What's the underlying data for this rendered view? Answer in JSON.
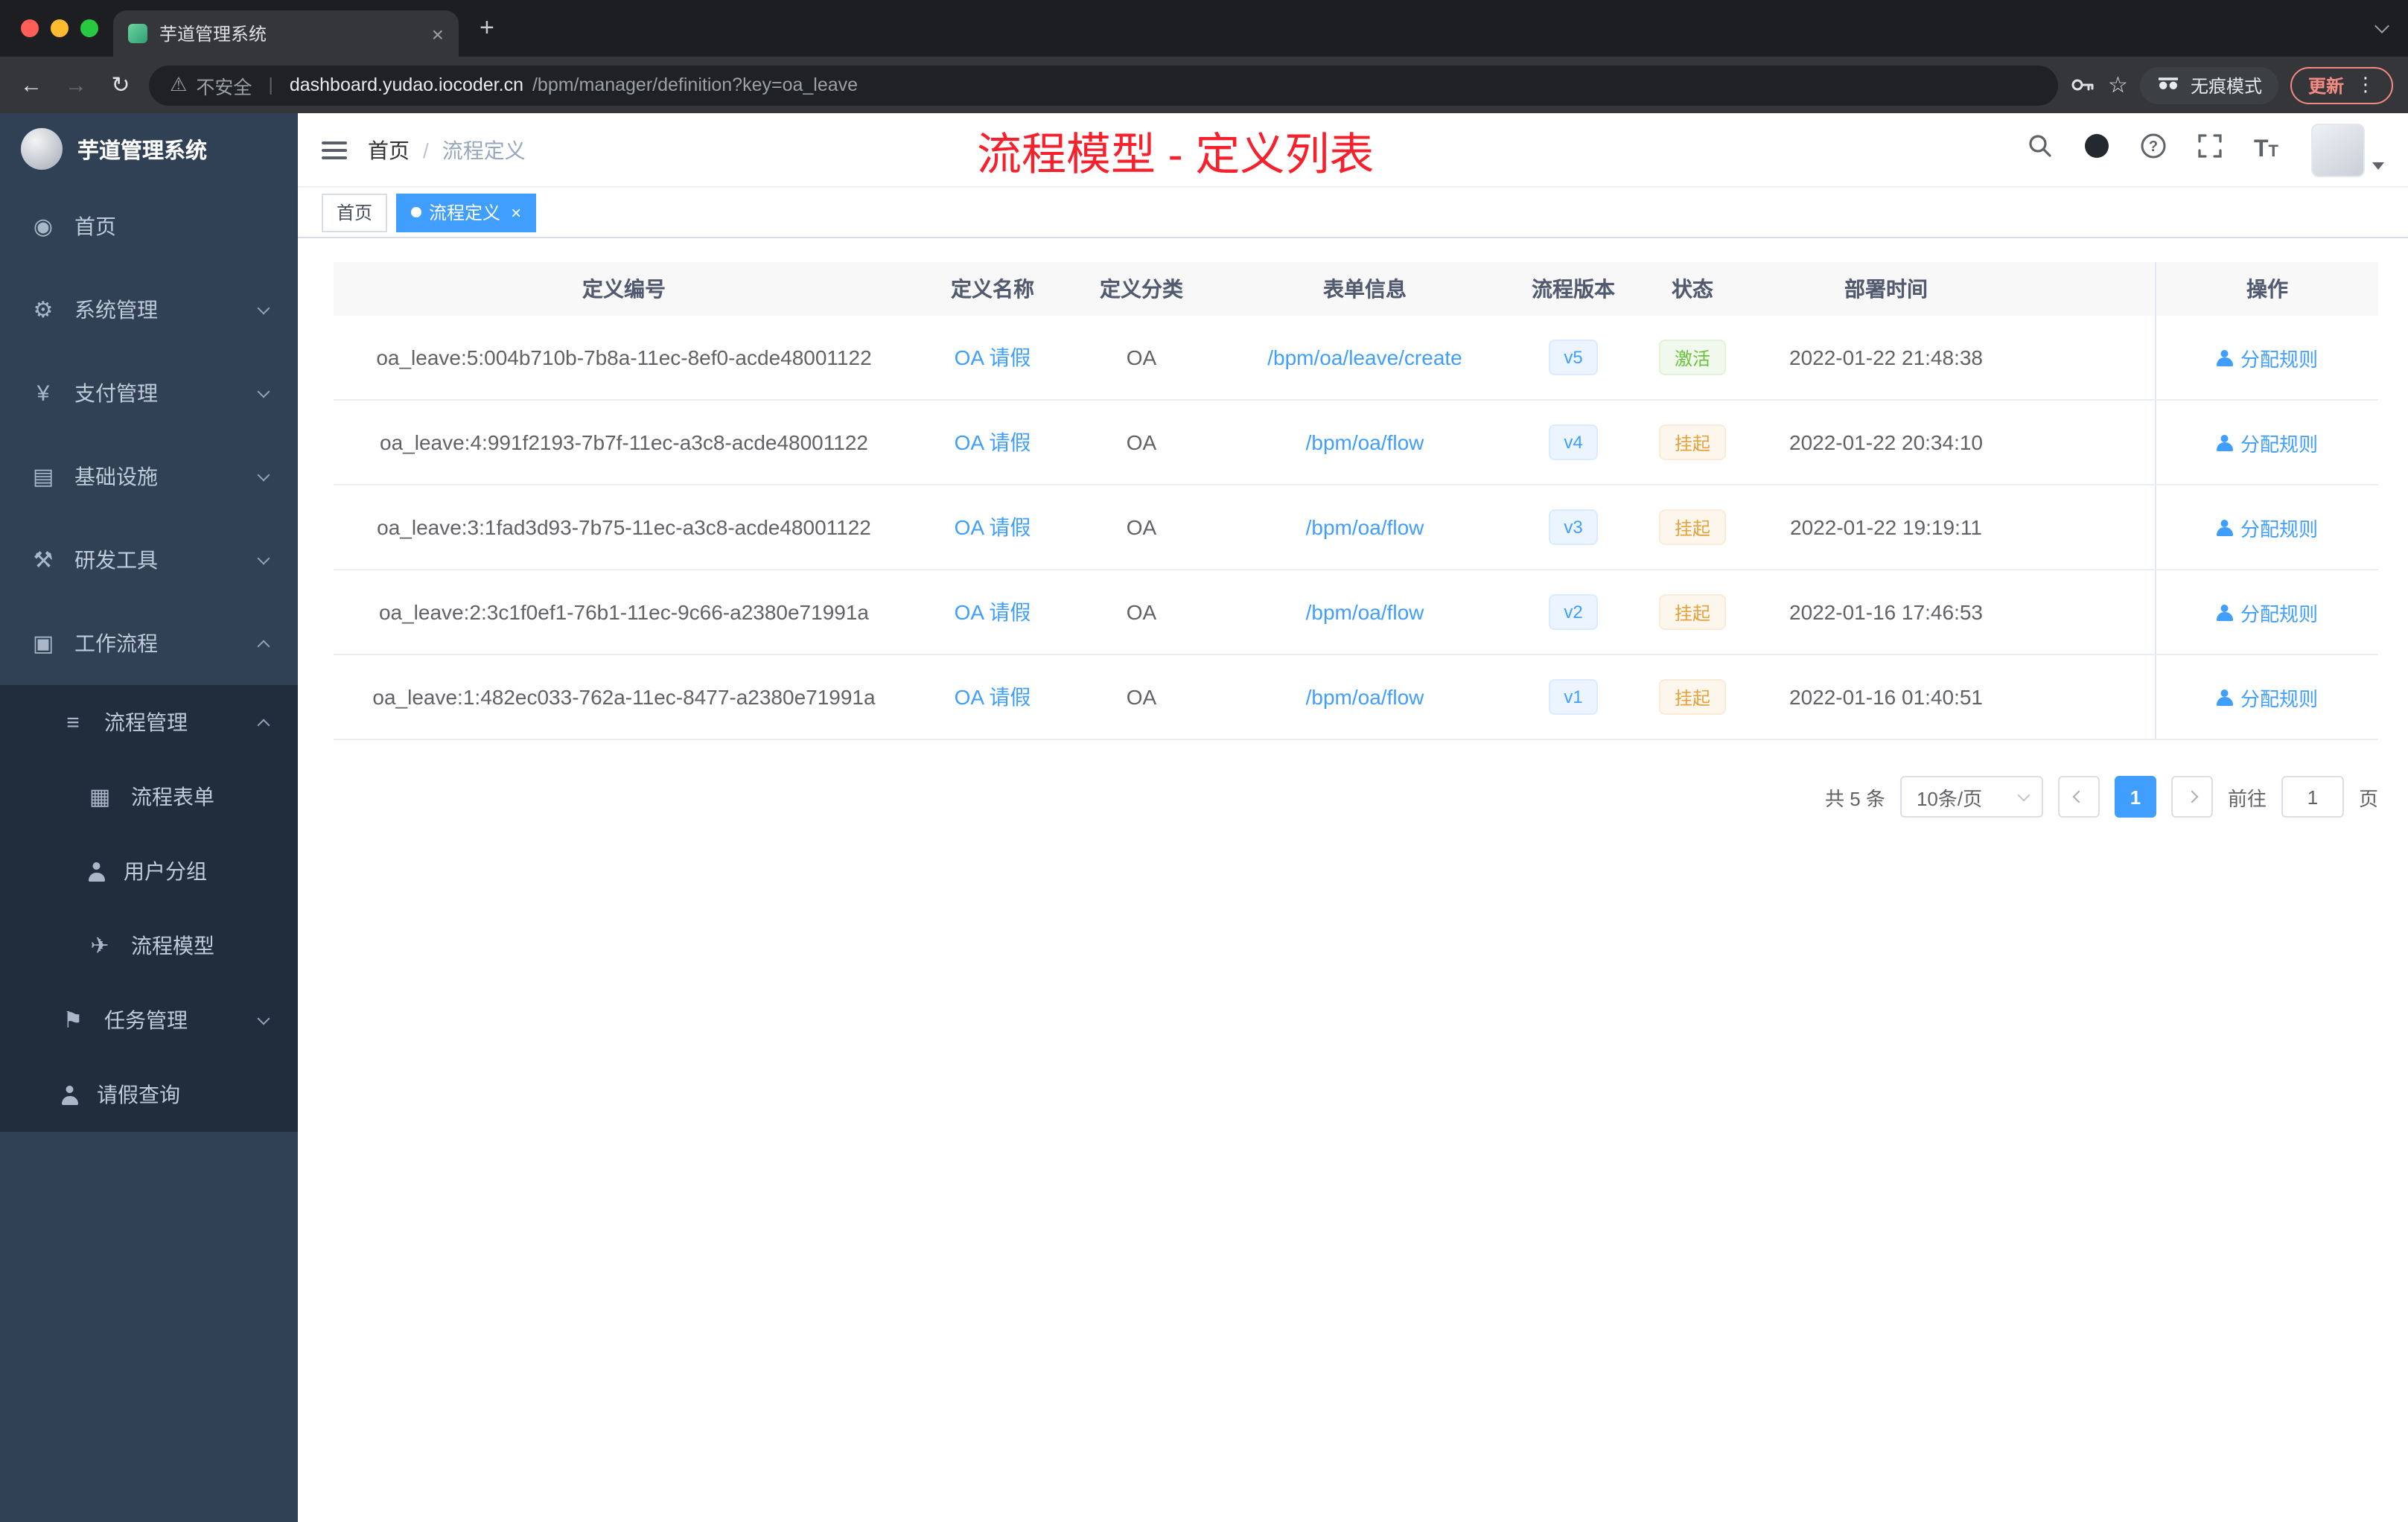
{
  "colors": {
    "accent": "#409eff",
    "annotation_red": "#f5222d",
    "success_green": "#67c23a",
    "warning_orange": "#e6a23c",
    "sidebar_bg": "#304156",
    "submenu_bg": "#1f2d3d"
  },
  "browser": {
    "tab_title": "芋道管理系统",
    "security_label": "不安全",
    "url_domain": "dashboard.yudao.iocoder.cn",
    "url_path": "/bpm/manager/definition?key=oa_leave",
    "incognito_label": "无痕模式",
    "update_label": "更新"
  },
  "sidebar": {
    "title": "芋道管理系统",
    "menu": [
      {
        "name": "home",
        "label": "首页",
        "icon": "dashboard-icon",
        "level": 1
      },
      {
        "name": "system-management",
        "label": "系统管理",
        "icon": "gear-icon",
        "level": 1,
        "arrow": "down"
      },
      {
        "name": "payment-management",
        "label": "支付管理",
        "icon": "yen-icon",
        "level": 1,
        "arrow": "down"
      },
      {
        "name": "infrastructure",
        "label": "基础设施",
        "icon": "infrastructure-icon",
        "level": 1,
        "arrow": "down"
      },
      {
        "name": "dev-tools",
        "label": "研发工具",
        "icon": "tools-icon",
        "level": 1,
        "arrow": "down"
      },
      {
        "name": "workflow",
        "label": "工作流程",
        "icon": "workflow-icon",
        "level": 1,
        "arrow": "up"
      },
      {
        "name": "process-management",
        "label": "流程管理",
        "icon": "process-list-icon",
        "level": 2,
        "arrow": "up",
        "insub": true
      },
      {
        "name": "process-form",
        "label": "流程表单",
        "icon": "form-icon",
        "level": 3,
        "insub": true
      },
      {
        "name": "user-group",
        "label": "用户分组",
        "icon": "user-group-icon",
        "level": 3,
        "insub": true
      },
      {
        "name": "process-model",
        "label": "流程模型",
        "icon": "paper-plane-icon",
        "level": 3,
        "insub": true
      },
      {
        "name": "task-management",
        "label": "任务管理",
        "icon": "task-flag-icon",
        "level": 2,
        "arrow": "down",
        "insub": true
      },
      {
        "name": "leave-query",
        "label": "请假查询",
        "icon": "person-icon",
        "level": 2,
        "insub": true
      }
    ]
  },
  "header": {
    "breadcrumb": {
      "home": "首页",
      "separator": "/",
      "current": "流程定义"
    },
    "annotation": "流程模型 - 定义列表"
  },
  "tags": [
    {
      "label": "首页",
      "active": false
    },
    {
      "label": "流程定义",
      "active": true
    }
  ],
  "table": {
    "columns": [
      {
        "key": "id",
        "label": "定义编号"
      },
      {
        "key": "name",
        "label": "定义名称"
      },
      {
        "key": "category",
        "label": "定义分类"
      },
      {
        "key": "form",
        "label": "表单信息"
      },
      {
        "key": "version",
        "label": "流程版本"
      },
      {
        "key": "status",
        "label": "状态"
      },
      {
        "key": "deploy_time",
        "label": "部署时间"
      },
      {
        "key": "action",
        "label": "操作"
      }
    ],
    "action_label": "分配规则",
    "rows": [
      {
        "id": "oa_leave:5:004b710b-7b8a-11ec-8ef0-acde48001122",
        "name": "OA 请假",
        "category": "OA",
        "form": "/bpm/oa/leave/create",
        "version": "v5",
        "status": "激活",
        "status_type": "success",
        "deploy_time": "2022-01-22 21:48:38"
      },
      {
        "id": "oa_leave:4:991f2193-7b7f-11ec-a3c8-acde48001122",
        "name": "OA 请假",
        "category": "OA",
        "form": "/bpm/oa/flow",
        "version": "v4",
        "status": "挂起",
        "status_type": "warning",
        "deploy_time": "2022-01-22 20:34:10"
      },
      {
        "id": "oa_leave:3:1fad3d93-7b75-11ec-a3c8-acde48001122",
        "name": "OA 请假",
        "category": "OA",
        "form": "/bpm/oa/flow",
        "version": "v3",
        "status": "挂起",
        "status_type": "warning",
        "deploy_time": "2022-01-22 19:19:11"
      },
      {
        "id": "oa_leave:2:3c1f0ef1-76b1-11ec-9c66-a2380e71991a",
        "name": "OA 请假",
        "category": "OA",
        "form": "/bpm/oa/flow",
        "version": "v2",
        "status": "挂起",
        "status_type": "warning",
        "deploy_time": "2022-01-16 17:46:53"
      },
      {
        "id": "oa_leave:1:482ec033-762a-11ec-8477-a2380e71991a",
        "name": "OA 请假",
        "category": "OA",
        "form": "/bpm/oa/flow",
        "version": "v1",
        "status": "挂起",
        "status_type": "warning",
        "deploy_time": "2022-01-16 01:40:51"
      }
    ]
  },
  "pagination": {
    "total": "共 5 条",
    "page_size": "10条/页",
    "current_page": "1",
    "goto_prefix": "前往",
    "goto_value": "1",
    "goto_suffix": "页"
  }
}
